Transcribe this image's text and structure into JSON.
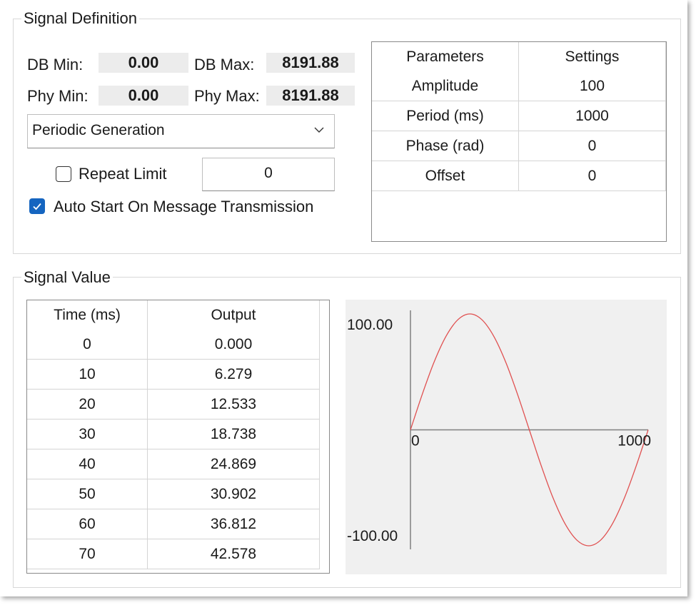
{
  "signal_definition": {
    "title": "Signal Definition",
    "db_min_label": "DB Min:",
    "db_min_value": "0.00",
    "db_max_label": "DB Max:",
    "db_max_value": "8191.88",
    "phy_min_label": "Phy Min:",
    "phy_min_value": "0.00",
    "phy_max_label": "Phy Max:",
    "phy_max_value": "8191.88",
    "generation_mode": "Periodic Generation",
    "repeat_limit_label": "Repeat Limit",
    "repeat_limit_checked": false,
    "repeat_limit_value": "0",
    "auto_start_label": "Auto Start On Message Transmission",
    "auto_start_checked": true,
    "parameters_table": {
      "headers": [
        "Parameters",
        "Settings"
      ],
      "rows": [
        [
          "Amplitude",
          "100"
        ],
        [
          "Period (ms)",
          "1000"
        ],
        [
          "Phase (rad)",
          "0"
        ],
        [
          "Offset",
          "0"
        ]
      ]
    }
  },
  "signal_value": {
    "title": "Signal Value",
    "table": {
      "headers": [
        "Time (ms)",
        "Output"
      ],
      "rows": [
        [
          "0",
          "0.000"
        ],
        [
          "10",
          "6.279"
        ],
        [
          "20",
          "12.533"
        ],
        [
          "30",
          "18.738"
        ],
        [
          "40",
          "24.869"
        ],
        [
          "50",
          "30.902"
        ],
        [
          "60",
          "36.812"
        ],
        [
          "70",
          "42.578"
        ]
      ]
    }
  },
  "chart_data": {
    "type": "line",
    "series": [
      {
        "x": [
          0,
          50,
          100,
          150,
          200,
          250,
          300,
          350,
          400,
          450,
          500,
          550,
          600,
          650,
          700,
          750,
          800,
          850,
          900,
          950,
          1000
        ],
        "values": [
          0,
          30.9,
          58.8,
          80.9,
          95.1,
          100,
          95.1,
          80.9,
          58.8,
          30.9,
          0,
          -30.9,
          -58.8,
          -80.9,
          -95.1,
          -100,
          -95.1,
          -80.9,
          -58.8,
          -30.9,
          0
        ]
      }
    ],
    "y_max_label": "100.00",
    "y_min_label": "-100.00",
    "x_min_label": "0",
    "x_max_label": "1000",
    "xlim": [
      0,
      1000
    ],
    "ylim": [
      -100,
      100
    ],
    "line_color": "#e05050",
    "axis_color": "#808080",
    "background_color": "#f0f0f0"
  }
}
